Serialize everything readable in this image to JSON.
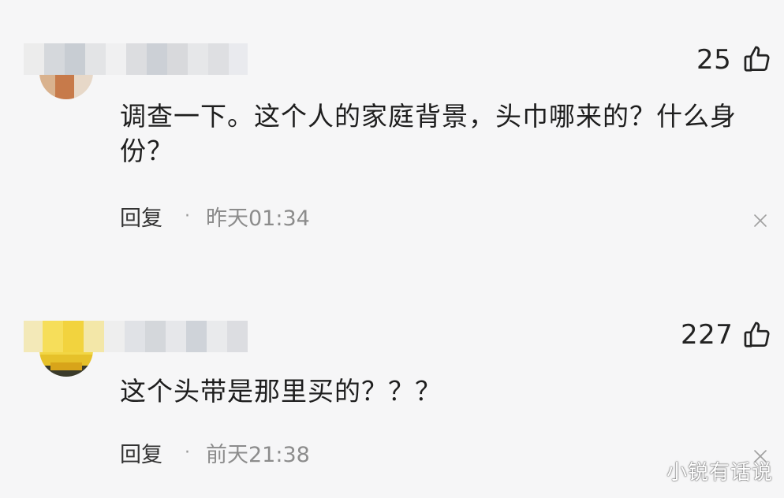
{
  "comments": [
    {
      "text": "调查一下。这个人的家庭背景，头巾哪来的？什么身份？",
      "likes": "25",
      "reply_label": "回复",
      "separator": "·",
      "timestamp": "昨天01:34"
    },
    {
      "text": "这个头带是那里买的？？？",
      "likes": "227",
      "reply_label": "回复",
      "separator": "·",
      "timestamp": "前天21:38"
    }
  ],
  "icons": {
    "like": "thumbs-up-icon",
    "close": "close-icon"
  },
  "watermark": "小锐有话说",
  "colors": {
    "background": "#f6f6f7",
    "text": "#1e1e1e",
    "muted": "#8c8c8c"
  }
}
